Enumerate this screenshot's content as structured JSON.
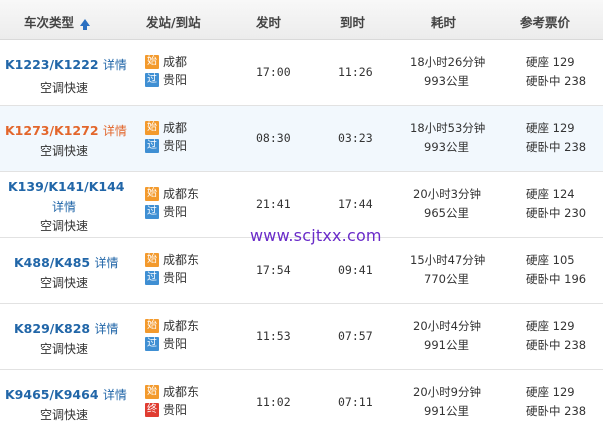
{
  "header": {
    "col_train": "车次类型",
    "col_station": "发站/到站",
    "col_depart": "发时",
    "col_arrive": "到时",
    "col_duration": "耗时",
    "col_price": "参考票价"
  },
  "badges": {
    "start": "始",
    "pass": "过",
    "end": "终"
  },
  "rows": [
    {
      "train": "K1223/K1222",
      "detail": "详情",
      "type": "空调快速",
      "from_badge": "始",
      "from": "成都",
      "to_badge": "过",
      "to": "贵阳",
      "depart": "17:00",
      "arrive": "11:26",
      "duration": "18小时26分钟",
      "distance": "993公里",
      "price1": "硬座 129",
      "price2": "硬卧中 238"
    },
    {
      "train": "K1273/K1272",
      "detail": "详情",
      "type": "空调快速",
      "from_badge": "始",
      "from": "成都",
      "to_badge": "过",
      "to": "贵阳",
      "depart": "08:30",
      "arrive": "03:23",
      "duration": "18小时53分钟",
      "distance": "993公里",
      "price1": "硬座 129",
      "price2": "硬卧中 238"
    },
    {
      "train": "K139/K141/K144",
      "detail": "详情",
      "type": "空调快速",
      "from_badge": "始",
      "from": "成都东",
      "to_badge": "过",
      "to": "贵阳",
      "depart": "21:41",
      "arrive": "17:44",
      "duration": "20小时3分钟",
      "distance": "965公里",
      "price1": "硬座 124",
      "price2": "硬卧中 230"
    },
    {
      "train": "K488/K485",
      "detail": "详情",
      "type": "空调快速",
      "from_badge": "始",
      "from": "成都东",
      "to_badge": "过",
      "to": "贵阳",
      "depart": "17:54",
      "arrive": "09:41",
      "duration": "15小时47分钟",
      "distance": "770公里",
      "price1": "硬座 105",
      "price2": "硬卧中 196"
    },
    {
      "train": "K829/K828",
      "detail": "详情",
      "type": "空调快速",
      "from_badge": "始",
      "from": "成都东",
      "to_badge": "过",
      "to": "贵阳",
      "depart": "11:53",
      "arrive": "07:57",
      "duration": "20小时4分钟",
      "distance": "991公里",
      "price1": "硬座 129",
      "price2": "硬卧中 238"
    },
    {
      "train": "K9465/K9464",
      "detail": "详情",
      "type": "空调快速",
      "from_badge": "始",
      "from": "成都东",
      "to_badge": "终",
      "to": "贵阳",
      "depart": "11:02",
      "arrive": "07:11",
      "duration": "20小时9分钟",
      "distance": "991公里",
      "price1": "硬座 129",
      "price2": "硬卧中 238"
    }
  ],
  "watermark": "www.scjtxx.com",
  "colors": {
    "link": "#2166a8",
    "highlight_link": "#e3662b",
    "badge_start": "#f39a2d",
    "badge_pass": "#3f8fd3",
    "badge_end": "#e03c31",
    "watermark": "#6a2cc9"
  }
}
